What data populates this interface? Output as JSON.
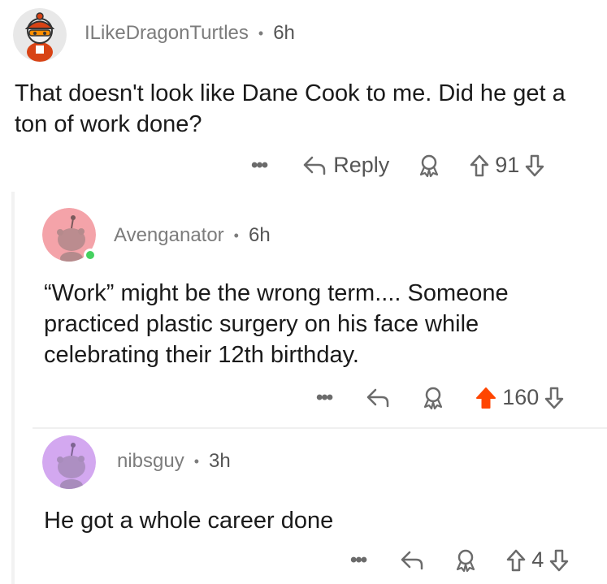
{
  "comments": [
    {
      "username": "ILikeDragonTurtles",
      "separator": "•",
      "time": "6h",
      "body": "That doesn't look like Dane Cook to me. Did he get a ton of work done?",
      "actions": {
        "more": "•••",
        "reply_label": "Reply",
        "votes": "91",
        "upvoted": false
      },
      "avatar_color": "#e0e0e0"
    },
    {
      "username": "Avenganator",
      "separator": "•",
      "time": "6h",
      "body": "“Work” might be the wrong term.... Someone practiced plastic surgery on his face while celebrating their 12th birthday.",
      "actions": {
        "more": "•••",
        "votes": "160",
        "upvoted": true
      },
      "avatar_color": "#f4a3a9",
      "online": true
    },
    {
      "username": "nibsguy",
      "separator": "•",
      "time": "3h",
      "body": "He got a whole career done",
      "actions": {
        "more": "•••",
        "votes": "4",
        "upvoted": false
      },
      "avatar_color": "#d3a8f0"
    }
  ],
  "colors": {
    "upvote_active": "#ff4500",
    "online": "#46d160",
    "meta_text": "#7c7c7c"
  },
  "icons": {
    "reply": "reply-arrow-icon",
    "award": "award-icon",
    "upvote": "upvote-arrow-icon",
    "downvote": "downvote-arrow-icon",
    "more": "more-options-icon"
  }
}
